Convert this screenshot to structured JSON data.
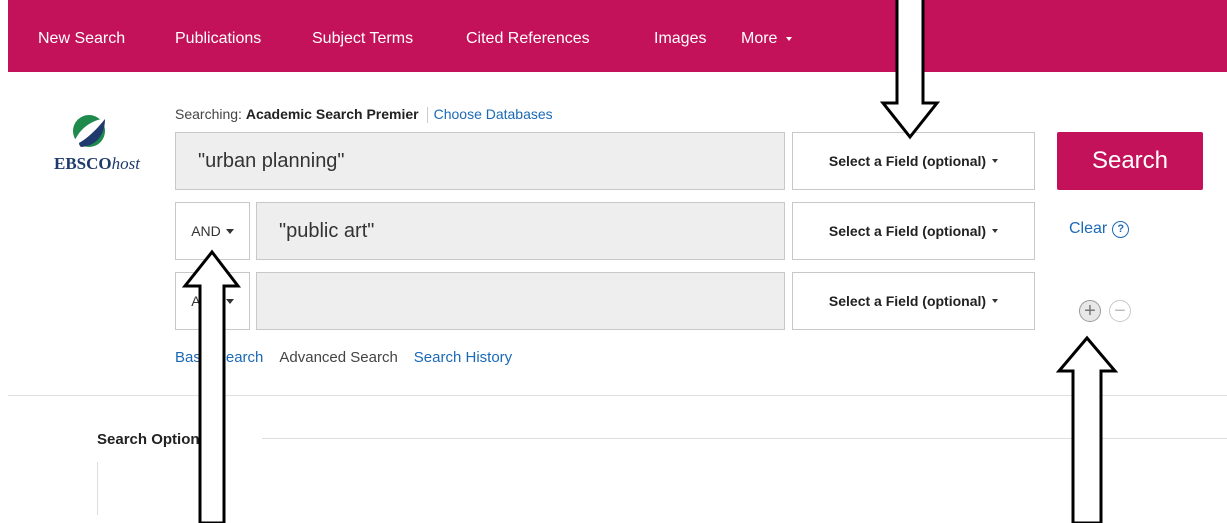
{
  "nav": {
    "items": [
      "New Search",
      "Publications",
      "Subject Terms",
      "Cited References",
      "Images",
      "More"
    ]
  },
  "logo": {
    "brand_bold": "EBSCO",
    "brand_italic": "host"
  },
  "searching": {
    "prefix": "Searching:",
    "database": "Academic Search Premier",
    "choose_link": "Choose Databases"
  },
  "rows": [
    {
      "bool": "",
      "value": "\"urban planning\"",
      "field": "Select a Field (optional)"
    },
    {
      "bool": "AND",
      "value": "\"public art\"",
      "field": "Select a Field (optional)"
    },
    {
      "bool": "AND",
      "value": "",
      "field": "Select a Field (optional)"
    }
  ],
  "search_button": "Search",
  "clear": {
    "label": "Clear",
    "help": "?"
  },
  "row_controls": {
    "add": "+",
    "remove": "−"
  },
  "bottom_links": {
    "basic": "Basic Search",
    "advanced": "Advanced Search",
    "history": "Search History"
  },
  "search_options": {
    "title": "Search Options"
  },
  "colors": {
    "brand": "#c4125a",
    "link": "#1b69b6"
  }
}
